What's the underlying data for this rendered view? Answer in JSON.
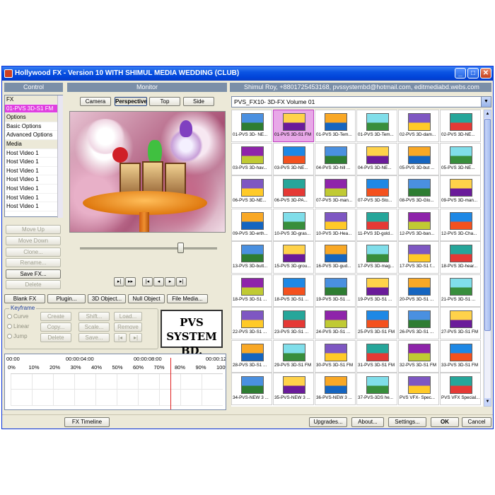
{
  "window": {
    "title": "Hollywood FX - Version 10 WITH SHIMUL MEDIA WEDDING (CLUB)"
  },
  "control": {
    "header": "Control",
    "list": [
      {
        "label": "FX",
        "kind": "grp"
      },
      {
        "label": "01-PVS 3D-S1 FM",
        "kind": "sel"
      },
      {
        "label": "Options",
        "kind": "grp"
      },
      {
        "label": "Basic Options",
        "kind": "item"
      },
      {
        "label": "Advanced Options",
        "kind": "item"
      },
      {
        "label": "Media",
        "kind": "grp"
      },
      {
        "label": "Host Video 1",
        "kind": "item"
      },
      {
        "label": "Host Video 1",
        "kind": "item"
      },
      {
        "label": "Host Video 1",
        "kind": "item"
      },
      {
        "label": "Host Video 1",
        "kind": "item"
      },
      {
        "label": "Host Video 1",
        "kind": "item"
      },
      {
        "label": "Host Video 1",
        "kind": "item"
      },
      {
        "label": "Host Video 1",
        "kind": "item"
      }
    ],
    "buttons": {
      "move_up": "Move Up",
      "move_down": "Move Down",
      "clone": "Clone...",
      "rename": "Rename...",
      "save_fx": "Save FX...",
      "delete": "Delete"
    }
  },
  "monitor": {
    "header": "Monitor",
    "views": {
      "camera": "Camera",
      "perspective": "Perspective",
      "top": "Top",
      "side": "Side"
    },
    "slider_position": 0.74,
    "transport": [
      "▶|",
      "|▶",
      "|◀",
      "◀",
      "▶",
      "▶|"
    ]
  },
  "object_buttons": {
    "blank_fx": "Blank FX",
    "plugin": "Plugin...",
    "object_3d": "3D Object...",
    "null_object": "Null Object",
    "file_media": "File Media..."
  },
  "keyframe": {
    "label": "Keyframe",
    "radios": [
      "Curve",
      "Linear",
      "Jump"
    ],
    "buttons": {
      "create": "Create",
      "copy": "Copy...",
      "delete": "Delete",
      "shift": "Shift...",
      "scale": "Scale...",
      "save": "Save...",
      "load": "Load...",
      "remove": "Remove"
    }
  },
  "logo": {
    "line1": "PVS",
    "line2": "SYSTEM BD."
  },
  "timeline": {
    "times": [
      "00:00",
      "00:00:04:00",
      "00:00:08:00",
      "00:00:12"
    ],
    "percents": [
      "0%",
      "10%",
      "20%",
      "30%",
      "40%",
      "50%",
      "60%",
      "70%",
      "80%",
      "90%",
      "100%"
    ]
  },
  "library": {
    "header": "Shimul Roy, +8801725453168, pvssystembd@hotmail.com, editmediabd.webs.com",
    "volume": "PVS_FX10- 3D-FX Volume 01",
    "selected_index": 1,
    "items": [
      "01-PVS 3D- NE...",
      "01-PVS 3D-S1 FM",
      "01-PVS 3D-Tem...",
      "01-PVS 3D-Tem...",
      "02-PVS 3D-dam...",
      "02-PVS 3D-NE...",
      "03-PVS 3D-hav...",
      "03-PVS 3D-NE...",
      "04-PVS 3D-hill ...",
      "04-PVS 3D-NE...",
      "05-PVS 3D-but ...",
      "05-PVS 3D-NE...",
      "06-PVS 3D-NE...",
      "06-PVS 3D-PA...",
      "07-PVS 3D-man...",
      "07-PVS 3D-Sto...",
      "08-PVS 3D-Glo...",
      "09-PVS 3D-man...",
      "09-PVS 3D-erth...",
      "10-PVS 3D-gras...",
      "10-PVS 3D-Hea...",
      "11-PVS 3D-gold...",
      "12-PVS 3D-ban...",
      "12-PVS 3D-Cha...",
      "13-PVS 3D-butt...",
      "15-PVS 3D-grou...",
      "16-PVS 3D-gud...",
      "17-PVS 3D-mag...",
      "17-PVS 3D-S1 f...",
      "18-PVS 3D-hear...",
      "18-PVS 3D-S1 ...",
      "18-PVS 3D-S1 ...",
      "19-PVS 3D-S1 ...",
      "19-PVS 3D-S1 ...",
      "20-PVS 3D-S1 ...",
      "21-PVS 3D-S1 ...",
      "22-PVS 3D-S1 ...",
      "23-PVS 3D-S1 ...",
      "24-PVS 3D-S1 ...",
      "25-PVS 3D-S1 FM",
      "26-PVS 3D-S1 ...",
      "27-PVS 3D-S1 FM",
      "28-PVS 3D-S1 ...",
      "29-PVS 3D-S1 FM",
      "30-PVS 3D-S1 FM",
      "31-PVS 3D-S1 FM",
      "32-PVS 3D-S1 FM",
      "33-PVS 3D-S1 FM",
      "34-PVS-NEW 3 ...",
      "35-PVS-NEW 3 ...",
      "36-PVS-NEW 3 ...",
      "37-PVS-3DS he...",
      "PVS VFX- Spec...",
      "PVS VFX Special..."
    ]
  },
  "bottom": {
    "fx_timeline": "FX Timeline",
    "upgrades": "Upgrades...",
    "about": "About...",
    "settings": "Settings...",
    "ok": "OK",
    "cancel": "Cancel"
  }
}
